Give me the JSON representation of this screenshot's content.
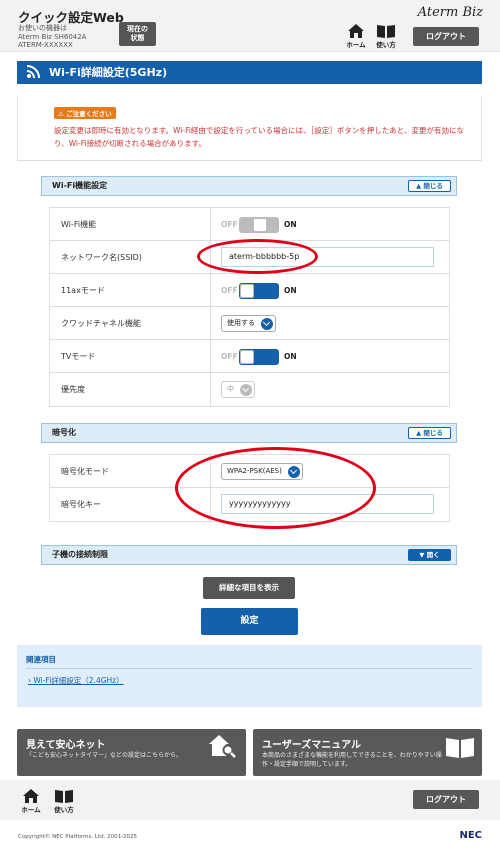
{
  "header": {
    "app_title": "クイック設定Web",
    "device_label": "お使いの機器は",
    "device_model": "Aterm Biz SH6042A",
    "device_id": "ATERM-XXXXXX",
    "status_line1": "現在の",
    "status_line2": "状態",
    "brand": "Aterm Biz",
    "home_label": "ホーム",
    "help_label": "使い方",
    "logout_label": "ログアウト"
  },
  "page": {
    "title": "Wi-Fi詳細設定(5GHz)"
  },
  "notice": {
    "badge": "ご注意ください",
    "text": "設定変更は即時に有効となります。Wi-Fi経由で設定を行っている場合には、［設定］ボタンを押したあと、変更が有効になり、Wi-Fi接続が切断される場合があります。"
  },
  "wifi_section": {
    "title": "Wi-Fi機能設定",
    "toggle_label": "閉じる",
    "rows": [
      {
        "label": "Wi-Fi機能",
        "off": "OFF",
        "on": "ON",
        "state": "off"
      },
      {
        "label": "ネットワーク名(SSID)",
        "value": "aterm-bbbbbb-5p"
      },
      {
        "label": "11axモード",
        "off": "OFF",
        "on": "ON",
        "state": "on"
      },
      {
        "label": "クワッドチャネル機能",
        "value": "使用する"
      },
      {
        "label": "TVモード",
        "off": "OFF",
        "on": "ON",
        "state": "on"
      },
      {
        "label": "優先度",
        "value": "中"
      }
    ]
  },
  "encryption_section": {
    "title": "暗号化",
    "toggle_label": "閉じる",
    "rows": [
      {
        "label": "暗号化モード",
        "value": "WPA2-PSK(AES)"
      },
      {
        "label": "暗号化キー",
        "value": "yyyyyyyyyyyyy"
      }
    ]
  },
  "child_section": {
    "title": "子機の接続制限",
    "toggle_label": "開く"
  },
  "buttons": {
    "detail": "詳細な項目を表示",
    "set": "設定"
  },
  "related": {
    "title": "関連項目",
    "link": "Wi-Fi詳細設定（2.4GHz）"
  },
  "banners": {
    "left_title": "見えて安心ネット",
    "left_sub": "「こども安心ネットタイマー」などの設定はこちらから。",
    "right_title": "ユーザーズマニュアル",
    "right_sub1": "本商品のさまざまな機能を利用してできることを、わかりやすい操",
    "right_sub2": "作・設定手順で説明しています。"
  },
  "footer": {
    "home_label": "ホーム",
    "help_label": "使い方",
    "logout_label": "ログアウト",
    "copyright": "Copyright© NEC Platforms, Ltd. 2001-2025",
    "nec": "NEC"
  },
  "colors": {
    "primary": "#1560aa",
    "dark_button": "#555555",
    "highlight": "#e1001a",
    "notice_text": "#cc3333"
  }
}
